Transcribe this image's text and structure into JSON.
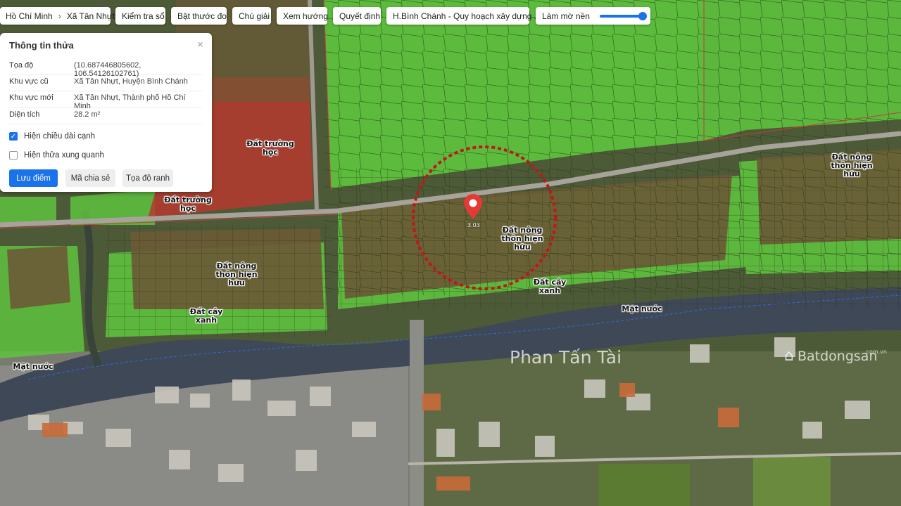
{
  "toolbar": {
    "breadcrumb": [
      "Hồ Chí Minh",
      "Xã Tân Nhựt"
    ],
    "buttons": [
      "Kiểm tra sổ",
      "Bật thước đo",
      "Chú giải",
      "Xem hướng",
      "Quyết định"
    ],
    "layer_select": "H.Bình Chánh - Quy hoạch xây dựng",
    "blur_label": "Làm mờ nền",
    "blur_level": 0.85
  },
  "panel": {
    "title": "Thông tin thửa",
    "close": "×",
    "rows": [
      {
        "key": "Tọa độ",
        "value": "(10.687446805602, 106.54126102761)"
      },
      {
        "key": "Khu vực cũ",
        "value": "Xã Tân Nhựt, Huyện Bình Chánh"
      },
      {
        "key": "Khu vực mới",
        "value": "Xã Tân Nhựt, Thành phố Hồ Chí Minh"
      },
      {
        "key": "Diện tích",
        "value": "28.2 m²"
      }
    ],
    "checkboxes": [
      {
        "label": "Hiện chiều dài cạnh",
        "checked": true
      },
      {
        "label": "Hiện thửa xung quanh",
        "checked": false
      }
    ],
    "buttons": {
      "save": "Lưu điểm",
      "share": "Mã chia sẻ",
      "coords": "Tọa độ ranh"
    }
  },
  "map": {
    "labels": {
      "school_1": [
        "Đất trường",
        "học"
      ],
      "school_2": [
        "Đất trường",
        "học"
      ],
      "farm_left": [
        "Đất nông",
        "thôn hiện",
        "hữu"
      ],
      "farm_center": [
        "Đất nông",
        "thôn hiện",
        "hữu"
      ],
      "farm_right": [
        "Đất nông",
        "thôn hiện",
        "hữu"
      ],
      "green_left": [
        "Đất cây",
        "xanh"
      ],
      "green_center": [
        "Đất cây",
        "xanh"
      ],
      "water_left": "Mặt nước",
      "water_right": "Mặt nước"
    },
    "marker_text": "3.03",
    "watermark_name": "Phan Tấn Tài",
    "watermark_brand": "Batdongsan",
    "watermark_brand_suffix": ".com.vn",
    "colors": {
      "agri": "#6b5a36",
      "green_zone": "#5fc83e",
      "school": "#b53a2e",
      "water": "#3e4856",
      "marker": "#e53935"
    }
  }
}
